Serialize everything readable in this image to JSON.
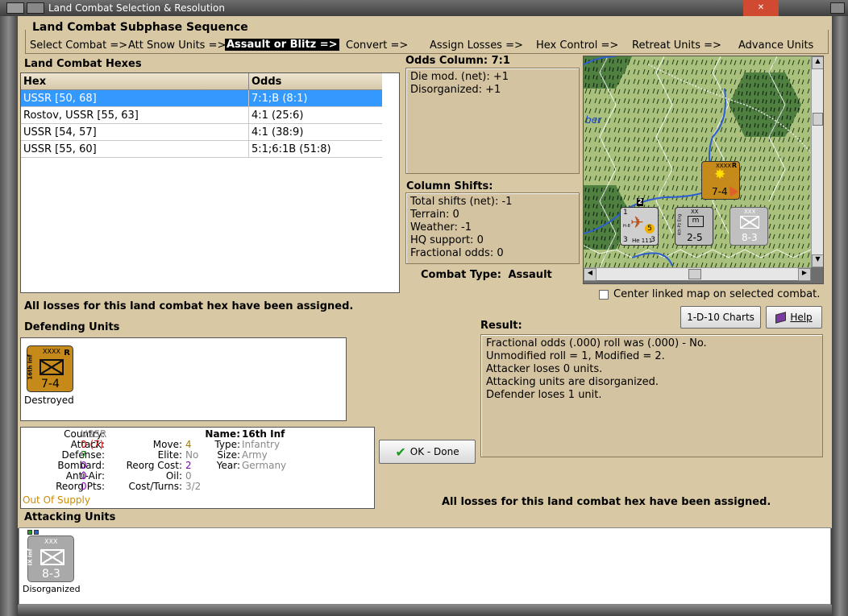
{
  "window": {
    "title": "Land Combat Selection & Resolution"
  },
  "subphase": {
    "title": "Land Combat Subphase Sequence",
    "steps": [
      {
        "label": "Select Combat =>",
        "active": false
      },
      {
        "label": "Att Snow Units =>",
        "active": false
      },
      {
        "label": "Assault or Blitz =>",
        "active": true
      },
      {
        "label": "Convert =>",
        "active": false
      },
      {
        "label": "Assign Losses =>",
        "active": false
      },
      {
        "label": "Hex Control =>",
        "active": false
      },
      {
        "label": "Retreat Units =>",
        "active": false
      },
      {
        "label": "Advance Units",
        "active": false
      }
    ]
  },
  "hexes": {
    "title": "Land Combat Hexes",
    "col_hex": "Hex",
    "col_odds": "Odds",
    "rows": [
      {
        "hex": "USSR [50, 68]",
        "odds": "7:1;B (8:1)",
        "selected": true
      },
      {
        "hex": "Rostov, USSR [55, 63]",
        "odds": "4:1 (25:6)",
        "selected": false
      },
      {
        "hex": "USSR [54, 57]",
        "odds": "4:1 (38:9)",
        "selected": false
      },
      {
        "hex": "USSR [55, 60]",
        "odds": "5:1;6:1B (51:8)",
        "selected": false
      }
    ]
  },
  "odds": {
    "title": "Odds Column: 7:1",
    "lines": [
      "Die mod. (net): +1",
      "Disorganized: +1"
    ]
  },
  "shifts": {
    "title": "Column Shifts:",
    "lines": [
      "Total shifts (net): -1",
      "Terrain: 0",
      "Weather: -1",
      "HQ support: 0",
      "Fractional odds: 0"
    ]
  },
  "combat_type": {
    "label": "Combat Type:",
    "value": "Assault"
  },
  "center_map": {
    "label": "Center linked map on selected combat.",
    "checked": false
  },
  "buttons": {
    "charts": "1-D-10 Charts",
    "help": "Help",
    "ok": "OK - Done"
  },
  "losses_msg_top": "All losses for this land combat hex have been assigned.",
  "losses_msg_bottom": "All losses for this land combat hex have been assigned.",
  "defending": {
    "title": "Defending Units",
    "unit": {
      "name": "16th Inf",
      "size": "XXXX",
      "tag": "R",
      "strength": "7-4",
      "status": "Destroyed"
    }
  },
  "result": {
    "title": "Result:",
    "lines": [
      "Fractional odds (.000) roll was (.000)  - No.",
      "Unmodified roll = 1, Modified = 2.",
      "Attacker loses 0 units.",
      "Attacking units are disorganized.",
      "Defender loses 1 unit."
    ]
  },
  "unit_info": {
    "country_label": "Country:",
    "country": "USSR",
    "attack_label": "Attack:",
    "attack": "0",
    "attack_paren": "(7)",
    "defense_label": "Defense:",
    "defense": "7",
    "bombard_label": "Bombard:",
    "bombard": "0",
    "antiair_label": "Anti-Air:",
    "antiair": "0",
    "reorg_pts_label": "Reorg Pts:",
    "reorg_pts": "0",
    "supply": "Out Of Supply",
    "move_label": "Move:",
    "move": "4",
    "elite_label": "Elite:",
    "elite": "No",
    "reorg_cost_label": "Reorg Cost:",
    "reorg_cost": "2",
    "oil_label": "Oil:",
    "oil": "0",
    "cost_turns_label": "Cost/Turns:",
    "cost_turns": "3/2",
    "name_label": "Name:",
    "name": "16th Inf",
    "type_label": "Type:",
    "type": "Infantry",
    "size_label": "Size:",
    "size": "Army",
    "year_label": "Year:",
    "year": "Germany"
  },
  "attacking": {
    "title": "Attacking Units",
    "unit": {
      "name": "IX Inf",
      "size": "XXX",
      "strength": "8-3",
      "status": "Disorganized"
    }
  },
  "map": {
    "label_fragment": "ber",
    "units": [
      {
        "name": "16th Inf",
        "size": "XXXX",
        "tag": "R",
        "strength": "7-4"
      },
      {
        "name": "He 111",
        "left": "1",
        "top": "2",
        "bottom_left": "3",
        "bottom_right": "3",
        "side": "H-8",
        "badge": "5"
      },
      {
        "name": "4th Pz Eng",
        "size": "XX",
        "strength": "2-5"
      },
      {
        "size": "XXX",
        "strength": "8-3"
      }
    ]
  },
  "colors": {
    "accent_blue": "#3399ff",
    "attack_red": "#d00000",
    "defense_green": "#008000",
    "purple": "#8000c0",
    "supply_orange": "#d08a00",
    "unit_orange": "#c58a1a"
  }
}
